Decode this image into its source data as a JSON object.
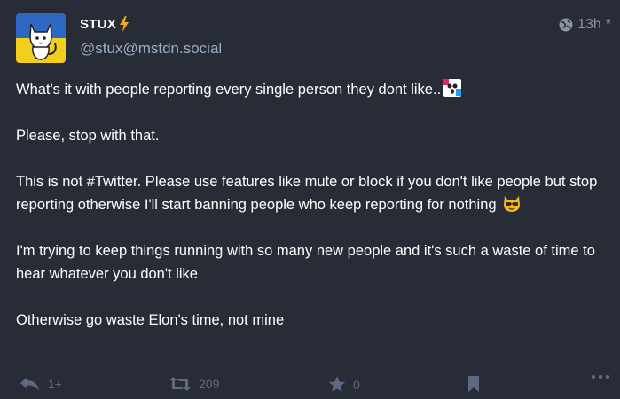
{
  "post": {
    "display_name": "STUX",
    "handle": "@stux@mstdn.social",
    "timestamp": "13h",
    "timestamp_suffix": "*",
    "paragraphs": {
      "p1": "What's it with people reporting every single person they dont like..",
      "p2": "Please, stop with that.",
      "p3_before": "This is not ",
      "p3_hashtag": "#Twitter",
      "p3_after": ". Please use features like mute or block if you don't like people but stop reporting otherwise I'll start banning people who keep reporting for nothing",
      "p4": "I'm trying to keep things running with so many new people and it's such a waste of time to hear whatever you don't like",
      "p5": "Otherwise go waste Elon's time, not mine"
    }
  },
  "actions": {
    "reply_count": "1+",
    "boost_count": "209",
    "favourite_count": "0"
  },
  "icons": {
    "name_emoji": "lightning-bolt-icon",
    "visibility": "globe-icon",
    "reply": "reply-icon",
    "boost": "boost-icon",
    "favourite": "star-icon",
    "bookmark": "bookmark-icon",
    "more": "ellipsis-icon"
  },
  "colors": {
    "background": "#282c37",
    "text": "#ffffff",
    "handle": "#9baec8",
    "action": "#606984",
    "bolt": "#f5a623"
  }
}
